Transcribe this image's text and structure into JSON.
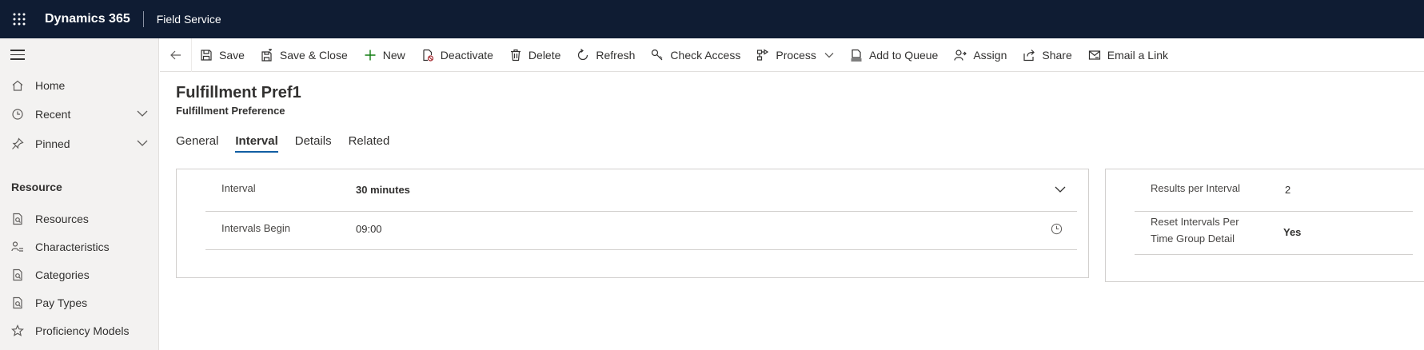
{
  "topbar": {
    "brand": "Dynamics 365",
    "app_name": "Field Service"
  },
  "sidebar": {
    "items": [
      {
        "label": "Home",
        "icon": "home-icon"
      },
      {
        "label": "Recent",
        "icon": "clock-icon",
        "expandable": true
      },
      {
        "label": "Pinned",
        "icon": "pin-icon",
        "expandable": true
      }
    ],
    "section_title": "Resource",
    "section_items": [
      {
        "label": "Resources",
        "icon": "document-search-icon"
      },
      {
        "label": "Characteristics",
        "icon": "person-list-icon"
      },
      {
        "label": "Categories",
        "icon": "document-search-icon"
      },
      {
        "label": "Pay Types",
        "icon": "document-search-icon"
      },
      {
        "label": "Proficiency Models",
        "icon": "star-icon"
      }
    ]
  },
  "commandbar": {
    "save": "Save",
    "save_close": "Save & Close",
    "new": "New",
    "deactivate": "Deactivate",
    "delete": "Delete",
    "refresh": "Refresh",
    "check_access": "Check Access",
    "process": "Process",
    "add_to_queue": "Add to Queue",
    "assign": "Assign",
    "share": "Share",
    "email_link": "Email a Link"
  },
  "record": {
    "title": "Fulfillment Pref1",
    "entity": "Fulfillment Preference"
  },
  "tabs": [
    "General",
    "Interval",
    "Details",
    "Related"
  ],
  "active_tab": "Interval",
  "interval_section": {
    "interval_label": "Interval",
    "interval_value": "30 minutes",
    "begin_label": "Intervals Begin",
    "begin_value": "09:00"
  },
  "results_section": {
    "results_label": "Results per Interval",
    "results_value": "2",
    "reset_label_line1": "Reset Intervals Per",
    "reset_label_line2": "Time Group Detail",
    "reset_value": "Yes"
  },
  "colors": {
    "topbar": "#0f1c33",
    "sidebar": "#f3f2f1",
    "accent": "#115ea3"
  }
}
